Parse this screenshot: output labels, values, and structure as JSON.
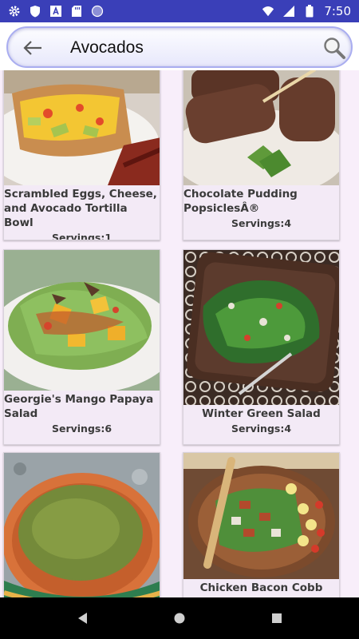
{
  "status_bar": {
    "time": "7:50",
    "icons_left": [
      "gear-icon",
      "shield-icon",
      "text-a-icon",
      "sd-card-icon",
      "circle-icon"
    ],
    "icons_right": [
      "wifi-icon",
      "signal-icon",
      "battery-icon"
    ]
  },
  "search": {
    "query": "Avocados"
  },
  "recipes": [
    {
      "title": "Scrambled Eggs, Cheese, and Avocado Tortilla Bowl",
      "servings": "Servings:1"
    },
    {
      "title": "Chocolate Pudding PopsiclesÂ®",
      "servings": "Servings:4"
    },
    {
      "title": "Georgie's Mango Papaya Salad",
      "servings": "Servings:6"
    },
    {
      "title": "Winter Green Salad",
      "servings": "Servings:4"
    },
    {
      "title": "",
      "servings": ""
    },
    {
      "title": "Chicken Bacon Cobb Salad",
      "servings": ""
    }
  ],
  "colors": {
    "status_bar": "#3a3fb8",
    "background": "#f8eefa",
    "card": "#f3eaf6",
    "nav_bar": "#000000"
  }
}
